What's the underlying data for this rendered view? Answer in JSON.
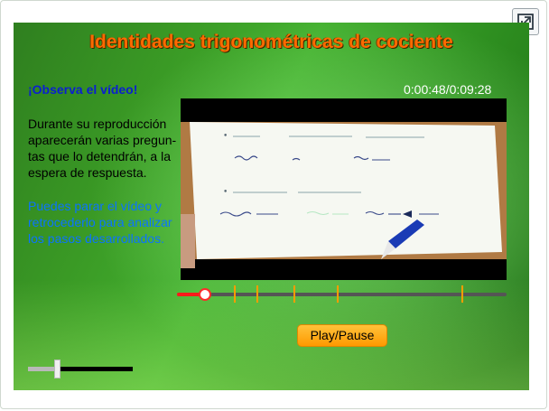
{
  "header": {
    "title": "Identidades trigonométricas de cociente"
  },
  "instructions": {
    "observe": "¡Observa el vídeo!",
    "description": "Durante su reproducción aparecerán varias pregun- tas que lo detendrán, a la espera de respuesta.",
    "hint": "Puedes parar el vídeo y retrocederlo para analizar los pasos desarrollados."
  },
  "player": {
    "time": "0:00:48/0:09:28",
    "progress_fraction": 0.084,
    "question_marks": [
      0.175,
      0.245,
      0.355,
      0.487,
      0.867
    ],
    "play_label": "Play/Pause",
    "volume_fraction": 0.28
  },
  "icons": {
    "expand": "expand-icon",
    "pen": "pen-icon"
  },
  "colors": {
    "title": "#ff6a00",
    "observe": "#0a1fd0",
    "hint": "#0b73ff",
    "progress": "#ff1a1a",
    "marks": "#ff9c00",
    "button": "#ffaa00"
  }
}
